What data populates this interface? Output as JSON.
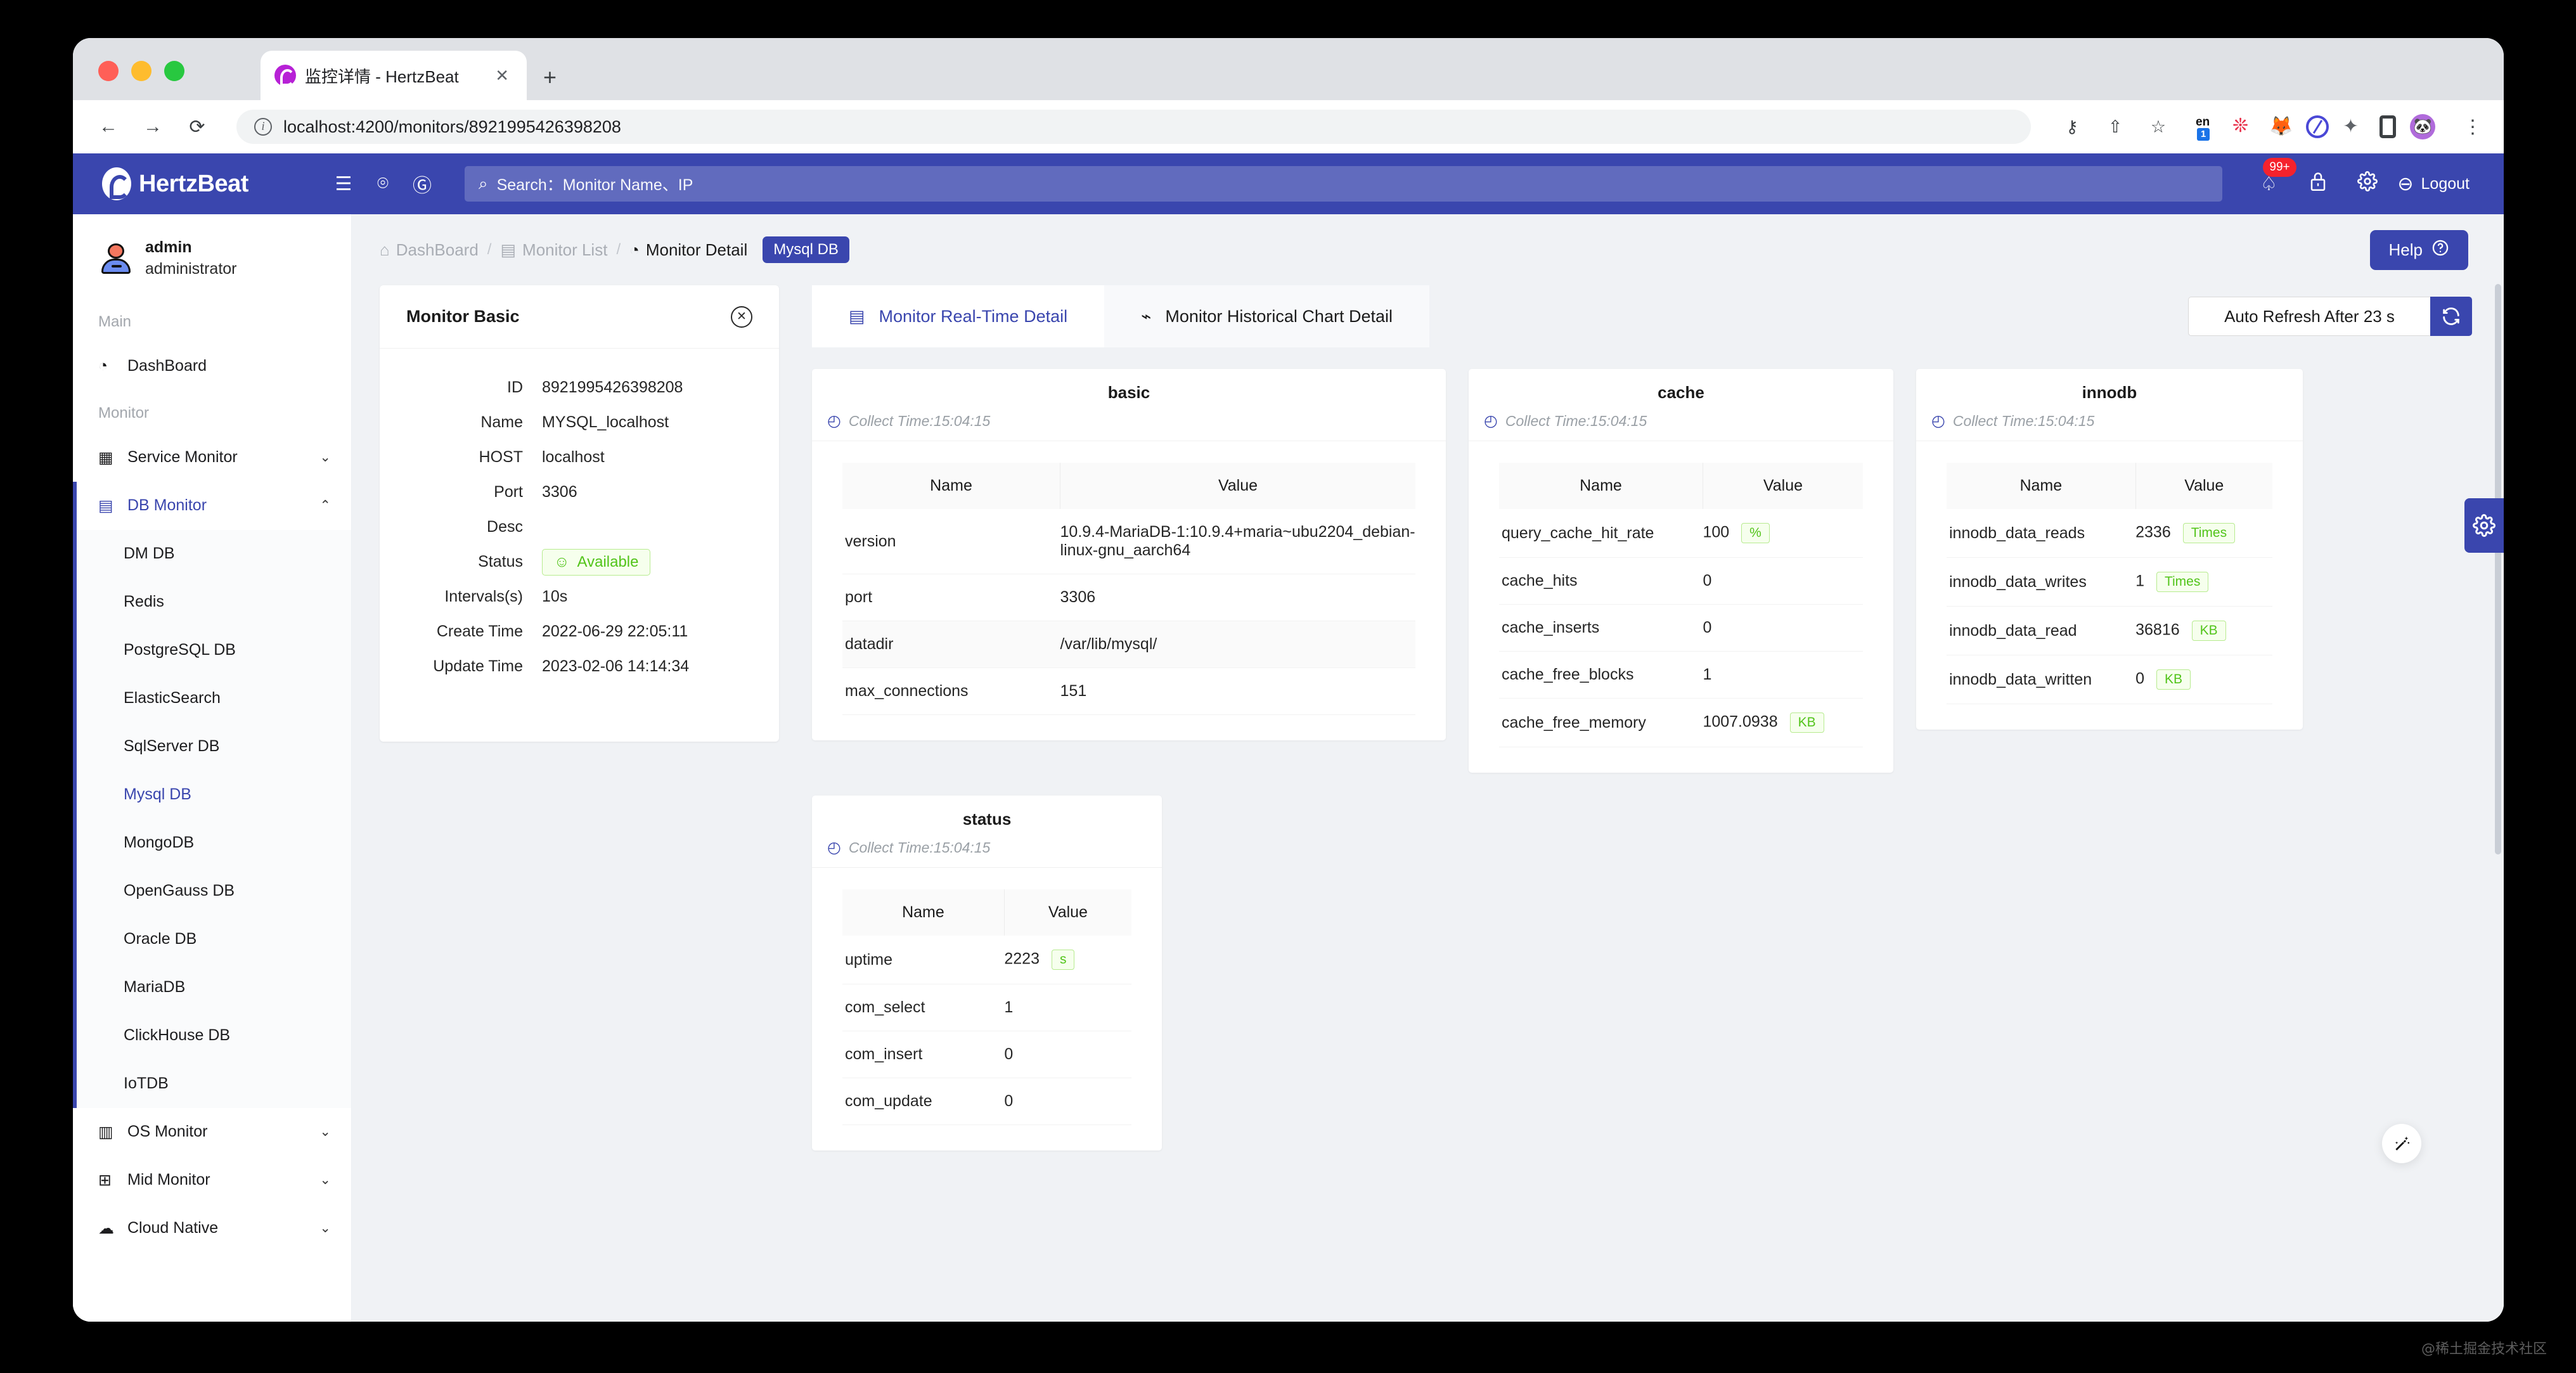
{
  "browser": {
    "tab_title": "监控详情 - HertzBeat",
    "tab_close": "✕",
    "new_tab": "+",
    "back": "←",
    "forward": "→",
    "reload": "⟳",
    "url": "localhost:4200/monitors/8921995426398208",
    "info_glyph": "i",
    "key_icon": "⚷",
    "share_icon": "⇧",
    "star_icon": "☆",
    "ime_label": "en",
    "ime_badge": "1",
    "menu_glyph": "⋮",
    "extensions": [
      "ime-icon",
      "dots-icon",
      "metamask-fox-icon",
      "circle-slash-icon",
      "puzzle-icon",
      "phone-icon",
      "panda-avatar-icon"
    ]
  },
  "header": {
    "brand": "HertzBeat",
    "menu_fold_icon": "☰",
    "github_icon": "⌾",
    "gitee_icon": "Ⓖ",
    "search_icon": "⌕",
    "search_placeholder": "Search：Monitor Name、IP",
    "bell_icon": "♤",
    "bell_badge": "99+",
    "lock_icon": "🔒",
    "gear_icon": "✹",
    "logout_icon": "⊖",
    "logout_label": "Logout",
    "accent": "#3a46ae"
  },
  "sidebar": {
    "user": {
      "name": "admin",
      "role": "administrator"
    },
    "groups": [
      {
        "title": "Main",
        "items": [
          {
            "label": "DashBoard",
            "icon": "◔",
            "has_chevron": false
          }
        ]
      },
      {
        "title": "Monitor",
        "items": [
          {
            "label": "Service Monitor",
            "icon": "▦",
            "has_chevron": true,
            "chevron": "⌄"
          },
          {
            "label": "DB Monitor",
            "icon": "▤",
            "has_chevron": true,
            "chevron": "⌃",
            "active": true
          }
        ]
      }
    ],
    "db_submenu": [
      "DM DB",
      "Redis",
      "PostgreSQL DB",
      "ElasticSearch",
      "SqlServer DB",
      "Mysql DB",
      "MongoDB",
      "OpenGauss DB",
      "Oracle DB",
      "MariaDB",
      "ClickHouse DB",
      "IoTDB"
    ],
    "db_submenu_current": "Mysql DB",
    "bottom_items": [
      {
        "label": "OS Monitor",
        "icon": "▥",
        "chevron": "⌄"
      },
      {
        "label": "Mid Monitor",
        "icon": "⊞",
        "chevron": "⌄"
      },
      {
        "label": "Cloud Native",
        "icon": "☁",
        "chevron": "⌄"
      }
    ]
  },
  "breadcrumb": {
    "items": [
      {
        "label": "DashBoard",
        "icon": "⌂",
        "current": false
      },
      {
        "label": "Monitor List",
        "icon": "▤",
        "current": false
      },
      {
        "label": "Monitor Detail",
        "icon": "◔",
        "current": true
      }
    ],
    "separator": "/",
    "tag": "Mysql DB",
    "help_label": "Help",
    "help_icon": "?"
  },
  "monitor_basic": {
    "title": "Monitor Basic",
    "close_icon": "✕",
    "rows": [
      {
        "label": "ID",
        "value": "8921995426398208"
      },
      {
        "label": "Name",
        "value": "MYSQL_localhost"
      },
      {
        "label": "HOST",
        "value": "localhost"
      },
      {
        "label": "Port",
        "value": "3306"
      },
      {
        "label": "Desc",
        "value": ""
      },
      {
        "label": "Status",
        "value": "Available",
        "badge": true,
        "badge_icon": "☺"
      },
      {
        "label": "Intervals(s)",
        "value": "10s"
      },
      {
        "label": "Create Time",
        "value": "2022-06-29 22:05:11"
      },
      {
        "label": "Update Time",
        "value": "2023-02-06 14:14:34"
      }
    ]
  },
  "tabs": [
    {
      "label": "Monitor Real-Time Detail",
      "icon": "▤",
      "active": true
    },
    {
      "label": "Monitor Historical Chart Detail",
      "icon": "⌁",
      "active": false
    }
  ],
  "refresh": {
    "text": "Auto Refresh After 23 s",
    "button_icon": "⟳"
  },
  "metric_cards": [
    {
      "id": "basic",
      "title": "basic",
      "collect_time": "Collect Time:15:04:15",
      "clock_icon": "◴",
      "columns": [
        "Name",
        "Value"
      ],
      "rows": [
        {
          "name": "version",
          "value": "10.9.4-MariaDB-1:10.9.4+maria~ubu2204_debian-linux-gnu_aarch64",
          "unit": ""
        },
        {
          "name": "port",
          "value": "3306",
          "unit": ""
        },
        {
          "name": "datadir",
          "value": "/var/lib/mysql/",
          "unit": ""
        },
        {
          "name": "max_connections",
          "value": "151",
          "unit": ""
        }
      ]
    },
    {
      "id": "cache",
      "title": "cache",
      "collect_time": "Collect Time:15:04:15",
      "clock_icon": "◴",
      "columns": [
        "Name",
        "Value"
      ],
      "rows": [
        {
          "name": "query_cache_hit_rate",
          "value": "100",
          "unit": "%"
        },
        {
          "name": "cache_hits",
          "value": "0",
          "unit": ""
        },
        {
          "name": "cache_inserts",
          "value": "0",
          "unit": ""
        },
        {
          "name": "cache_free_blocks",
          "value": "1",
          "unit": ""
        },
        {
          "name": "cache_free_memory",
          "value": "1007.0938",
          "unit": "KB"
        }
      ]
    },
    {
      "id": "innodb",
      "title": "innodb",
      "collect_time": "Collect Time:15:04:15",
      "clock_icon": "◴",
      "columns": [
        "Name",
        "Value"
      ],
      "rows": [
        {
          "name": "innodb_data_reads",
          "value": "2336",
          "unit": "Times"
        },
        {
          "name": "innodb_data_writes",
          "value": "1",
          "unit": "Times"
        },
        {
          "name": "innodb_data_read",
          "value": "36816",
          "unit": "KB"
        },
        {
          "name": "innodb_data_written",
          "value": "0",
          "unit": "KB"
        }
      ]
    },
    {
      "id": "status",
      "title": "status",
      "collect_time": "Collect Time:15:04:15",
      "clock_icon": "◴",
      "columns": [
        "Name",
        "Value"
      ],
      "rows": [
        {
          "name": "uptime",
          "value": "2223",
          "unit": "s"
        },
        {
          "name": "com_select",
          "value": "1",
          "unit": ""
        },
        {
          "name": "com_insert",
          "value": "0",
          "unit": ""
        },
        {
          "name": "com_update",
          "value": "0",
          "unit": ""
        }
      ]
    }
  ],
  "floating": {
    "gear_icon": "✹",
    "wand_icon": "✨"
  },
  "watermark": "@稀土掘金技术社区"
}
